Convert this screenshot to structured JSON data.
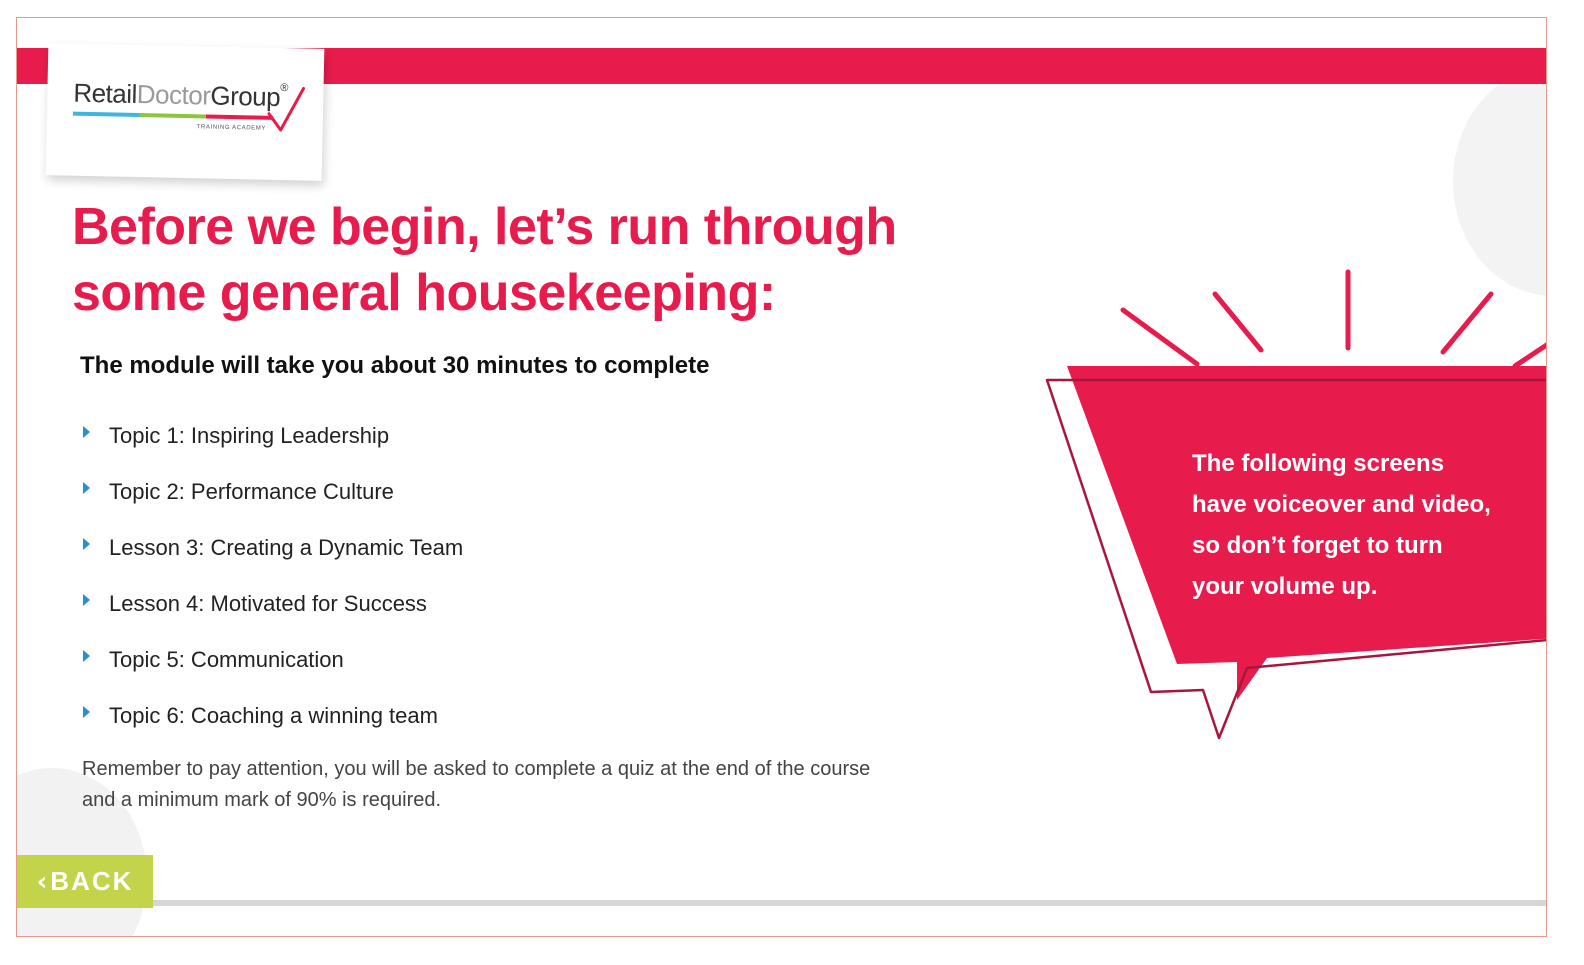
{
  "logo": {
    "word_retail": "Retail",
    "word_doctor": "Doctor",
    "word_group": "Group",
    "registered": "®",
    "tagline": "TRAINING ACADEMY",
    "stripe_colors": [
      "#3fb5e0",
      "#8cc63f",
      "#e81c4c"
    ]
  },
  "heading": {
    "line1": "Before we begin, let’s run through",
    "line2": "some general housekeeping:"
  },
  "duration_text": "The module will take you about 30 minutes to complete",
  "topics": [
    {
      "label": "Topic 1: Inspiring Leadership"
    },
    {
      "label": "Topic 2: Performance Culture"
    },
    {
      "label": "Lesson 3: Creating a Dynamic Team"
    },
    {
      "label": "Lesson 4: Motivated for Success"
    },
    {
      "label": "Topic 5: Communication"
    },
    {
      "label": "Topic 6: Coaching a winning team"
    }
  ],
  "reminder": {
    "line1": "Remember to pay attention, you will be asked to complete a quiz at the end of the course",
    "line2": "and a minimum mark of 90% is required."
  },
  "callout": {
    "line1": "The following screens",
    "line2": "have voiceover and video,",
    "line3": "so don’t forget to turn",
    "line4": "your volume up."
  },
  "back_button": {
    "icon": "chevron-left-icon",
    "label": "BACK"
  },
  "colors": {
    "brand_red": "#e81c4c",
    "dark_red_outline": "#a8163c",
    "back_green": "#c3d44a",
    "bullet_blue": "#2a8fc8"
  }
}
